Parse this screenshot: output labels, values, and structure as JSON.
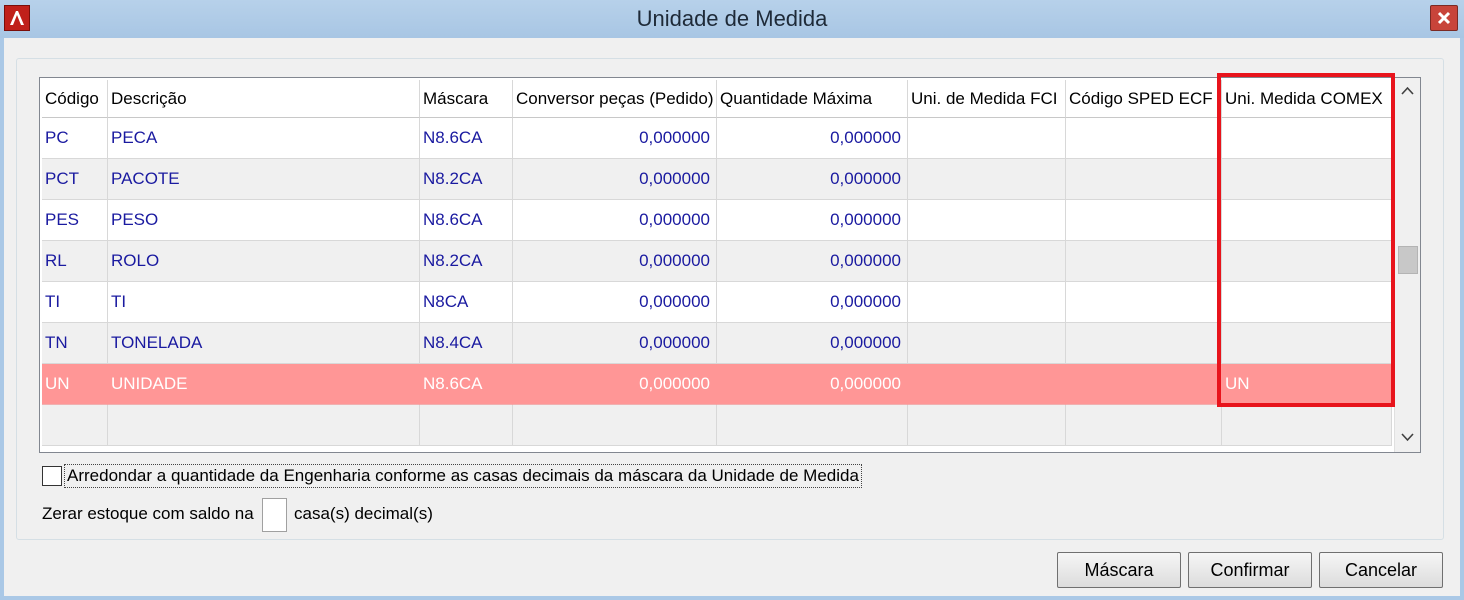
{
  "window": {
    "title": "Unidade de Medida"
  },
  "grid": {
    "columns": [
      "Código",
      "Descrição",
      "Máscara",
      "Conversor peças (Pedido)",
      "Quantidade Máxima",
      "Uni. de Medida FCI",
      "Código SPED ECF",
      "Uni. Medida COMEX"
    ],
    "rows": [
      [
        "PC",
        "PECA",
        "N8.6CA",
        "0,000000",
        "0,000000",
        "",
        "",
        ""
      ],
      [
        "PCT",
        "PACOTE",
        "N8.2CA",
        "0,000000",
        "0,000000",
        "",
        "",
        ""
      ],
      [
        "PES",
        "PESO",
        "N8.6CA",
        "0,000000",
        "0,000000",
        "",
        "",
        ""
      ],
      [
        "RL",
        "ROLO",
        "N8.2CA",
        "0,000000",
        "0,000000",
        "",
        "",
        ""
      ],
      [
        "TI",
        "TI",
        "N8CA",
        "0,000000",
        "0,000000",
        "",
        "",
        ""
      ],
      [
        "TN",
        "TONELADA",
        "N8.4CA",
        "0,000000",
        "0,000000",
        "",
        "",
        ""
      ],
      [
        "UN",
        "UNIDADE",
        "N8.6CA",
        "0,000000",
        "0,000000",
        "",
        "",
        "UN"
      ]
    ],
    "selected_row": 6
  },
  "options": {
    "round_label": "Arredondar a quantidade da Engenharia conforme as casas decimais da máscara da Unidade de Medida",
    "zerar_prefix": "Zerar estoque com saldo na",
    "zerar_suffix": "casa(s) decimal(s)",
    "zerar_value": ""
  },
  "buttons": {
    "mascara": "Máscara",
    "confirmar": "Confirmar",
    "cancelar": "Cancelar"
  },
  "colors": {
    "selected_row": "#ff9696",
    "highlight_box": "#e8141c",
    "cell_text": "#1a1aa0"
  },
  "icons": {
    "app": "app-logo-icon",
    "close": "close-icon",
    "scroll_up": "chevron-up-icon",
    "scroll_down": "chevron-down-icon"
  }
}
